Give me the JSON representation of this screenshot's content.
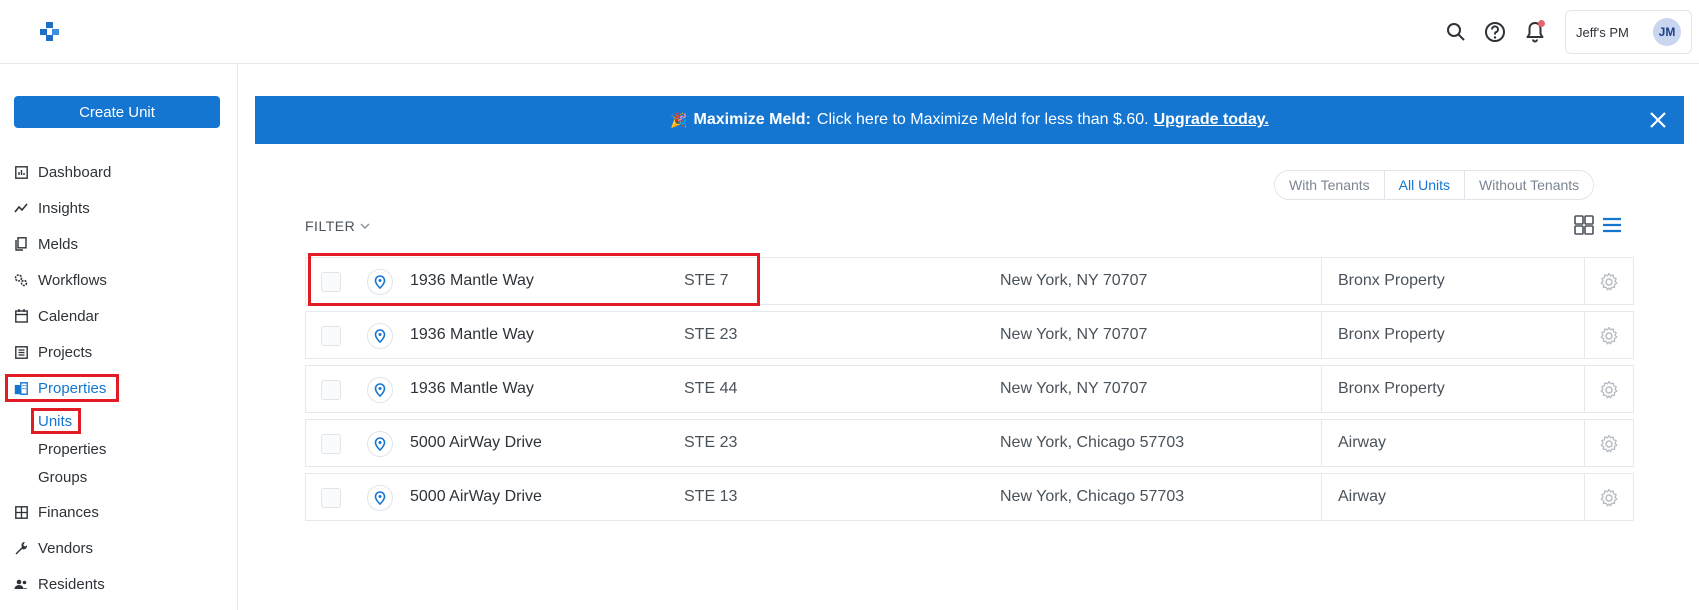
{
  "header": {
    "account_name": "Jeff's PM",
    "avatar_initials": "JM"
  },
  "sidebar": {
    "create_button": "Create Unit",
    "items": [
      {
        "label": "Dashboard",
        "icon": "dashboard-icon"
      },
      {
        "label": "Insights",
        "icon": "insights-icon"
      },
      {
        "label": "Melds",
        "icon": "melds-icon"
      },
      {
        "label": "Workflows",
        "icon": "workflows-icon"
      },
      {
        "label": "Calendar",
        "icon": "calendar-icon"
      },
      {
        "label": "Projects",
        "icon": "projects-icon"
      },
      {
        "label": "Properties",
        "icon": "properties-icon"
      },
      {
        "label": "Finances",
        "icon": "finances-icon"
      },
      {
        "label": "Vendors",
        "icon": "vendors-icon"
      },
      {
        "label": "Residents",
        "icon": "residents-icon"
      }
    ],
    "sub_items": [
      "Units",
      "Properties",
      "Groups"
    ],
    "active_item": "Properties",
    "active_sub_item": "Units"
  },
  "banner": {
    "emoji": "🎉",
    "bold": "Maximize Meld:",
    "text": "Click here to Maximize Meld for less than $.60.",
    "link": "Upgrade today."
  },
  "segments": [
    "With Tenants",
    "All Units",
    "Without Tenants"
  ],
  "active_segment": "All Units",
  "filter_label": "FILTER",
  "rows": [
    {
      "address": "1936 Mantle Way",
      "unit": "STE 7",
      "city": "New York, NY 70707",
      "property": "Bronx Property"
    },
    {
      "address": "1936 Mantle Way",
      "unit": "STE 23",
      "city": "New York, NY 70707",
      "property": "Bronx Property"
    },
    {
      "address": "1936 Mantle Way",
      "unit": "STE 44",
      "city": "New York, NY 70707",
      "property": "Bronx Property"
    },
    {
      "address": "5000 AirWay Drive",
      "unit": "STE 23",
      "city": "New York, Chicago 57703",
      "property": "Airway"
    },
    {
      "address": "5000 AirWay Drive",
      "unit": "STE 13",
      "city": "New York, Chicago 57703",
      "property": "Airway"
    }
  ],
  "colors": {
    "accent": "#1476d1",
    "highlight": "#e31b23"
  }
}
